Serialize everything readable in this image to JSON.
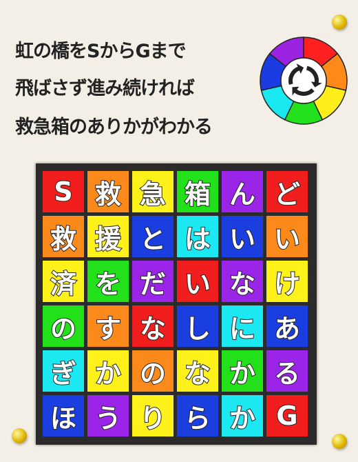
{
  "instructions": [
    "虹の橋をSからGまで",
    "飛ばさず進み続ければ",
    "救急箱のありかがわかる"
  ],
  "wheel": {
    "colors": [
      "#ff2020",
      "#ff8a1a",
      "#ffee1a",
      "#22e01a",
      "#1ae8f0",
      "#1a3ce0",
      "#9a22e0"
    ],
    "icon": "cycle-arrows-icon"
  },
  "palette": {
    "R": "#f21d1d",
    "O": "#fb8a1a",
    "Y": "#fff21a",
    "G": "#22e01a",
    "C": "#1ce8f2",
    "B": "#1a3ee0",
    "P": "#9a24e8"
  },
  "grid": [
    [
      {
        "t": "S",
        "c": "R"
      },
      {
        "t": "救",
        "c": "O"
      },
      {
        "t": "急",
        "c": "Y"
      },
      {
        "t": "箱",
        "c": "G"
      },
      {
        "t": "ん",
        "c": "P"
      },
      {
        "t": "ど",
        "c": "R"
      }
    ],
    [
      {
        "t": "救",
        "c": "O"
      },
      {
        "t": "援",
        "c": "Y"
      },
      {
        "t": "と",
        "c": "B"
      },
      {
        "t": "は",
        "c": "C"
      },
      {
        "t": "い",
        "c": "B"
      },
      {
        "t": "い",
        "c": "O"
      }
    ],
    [
      {
        "t": "済",
        "c": "Y"
      },
      {
        "t": "を",
        "c": "G"
      },
      {
        "t": "だ",
        "c": "P"
      },
      {
        "t": "い",
        "c": "R"
      },
      {
        "t": "な",
        "c": "P"
      },
      {
        "t": "け",
        "c": "Y"
      }
    ],
    [
      {
        "t": "の",
        "c": "G"
      },
      {
        "t": "す",
        "c": "O"
      },
      {
        "t": "な",
        "c": "R"
      },
      {
        "t": "し",
        "c": "B"
      },
      {
        "t": "に",
        "c": "C"
      },
      {
        "t": "あ",
        "c": "B"
      }
    ],
    [
      {
        "t": "ぎ",
        "c": "C"
      },
      {
        "t": "か",
        "c": "Y"
      },
      {
        "t": "の",
        "c": "O"
      },
      {
        "t": "な",
        "c": "Y"
      },
      {
        "t": "か",
        "c": "G"
      },
      {
        "t": "る",
        "c": "P"
      }
    ],
    [
      {
        "t": "ほ",
        "c": "B"
      },
      {
        "t": "う",
        "c": "P"
      },
      {
        "t": "り",
        "c": "Y"
      },
      {
        "t": "ら",
        "c": "B"
      },
      {
        "t": "か",
        "c": "C"
      },
      {
        "t": "G",
        "c": "R"
      }
    ]
  ]
}
